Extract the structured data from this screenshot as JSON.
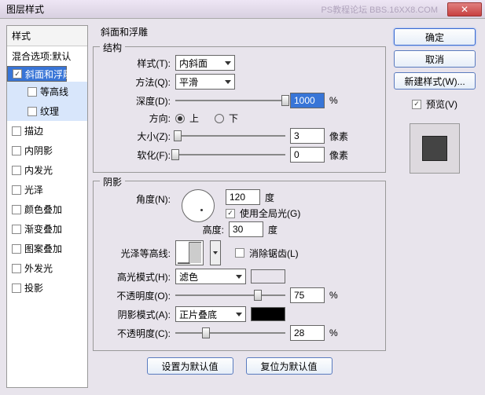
{
  "title": "图层样式",
  "watermark": "PS教程论坛 BBS.16XX8.COM",
  "sidebar": {
    "header": "样式",
    "blend": "混合选项:默认",
    "items": [
      {
        "label": "斜面和浮雕",
        "checked": true,
        "selected": true
      },
      {
        "label": "等高线",
        "sub": true
      },
      {
        "label": "纹理",
        "sub": true
      },
      {
        "label": "描边"
      },
      {
        "label": "内阴影"
      },
      {
        "label": "内发光"
      },
      {
        "label": "光泽"
      },
      {
        "label": "颜色叠加"
      },
      {
        "label": "渐变叠加"
      },
      {
        "label": "图案叠加"
      },
      {
        "label": "外发光"
      },
      {
        "label": "投影"
      }
    ]
  },
  "main": {
    "title": "斜面和浮雕",
    "structure": {
      "legend": "结构",
      "style_label": "样式(T):",
      "style_value": "内斜面",
      "method_label": "方法(Q):",
      "method_value": "平滑",
      "depth_label": "深度(D):",
      "depth_value": "1000",
      "depth_unit": "%",
      "direction_label": "方向:",
      "up": "上",
      "down": "下",
      "size_label": "大小(Z):",
      "size_value": "3",
      "size_unit": "像素",
      "soften_label": "软化(F):",
      "soften_value": "0",
      "soften_unit": "像素"
    },
    "shading": {
      "legend": "阴影",
      "angle_label": "角度(N):",
      "angle_value": "120",
      "angle_unit": "度",
      "global": "使用全局光(G)",
      "altitude_label": "高度:",
      "altitude_value": "30",
      "altitude_unit": "度",
      "gloss_label": "光泽等高线:",
      "antialias": "消除锯齿(L)",
      "highlight_mode_label": "高光模式(H):",
      "highlight_mode": "滤色",
      "highlight_opacity_label": "不透明度(O):",
      "highlight_opacity": "75",
      "pct": "%",
      "shadow_mode_label": "阴影模式(A):",
      "shadow_mode": "正片叠底",
      "shadow_opacity_label": "不透明度(C):",
      "shadow_opacity": "28",
      "highlight_color": "#ffffff",
      "shadow_color": "#000000"
    },
    "reset_default": "设置为默认值",
    "restore_default": "复位为默认值"
  },
  "right": {
    "ok": "确定",
    "cancel": "取消",
    "new_style": "新建样式(W)...",
    "preview_label": "预览(V)"
  }
}
